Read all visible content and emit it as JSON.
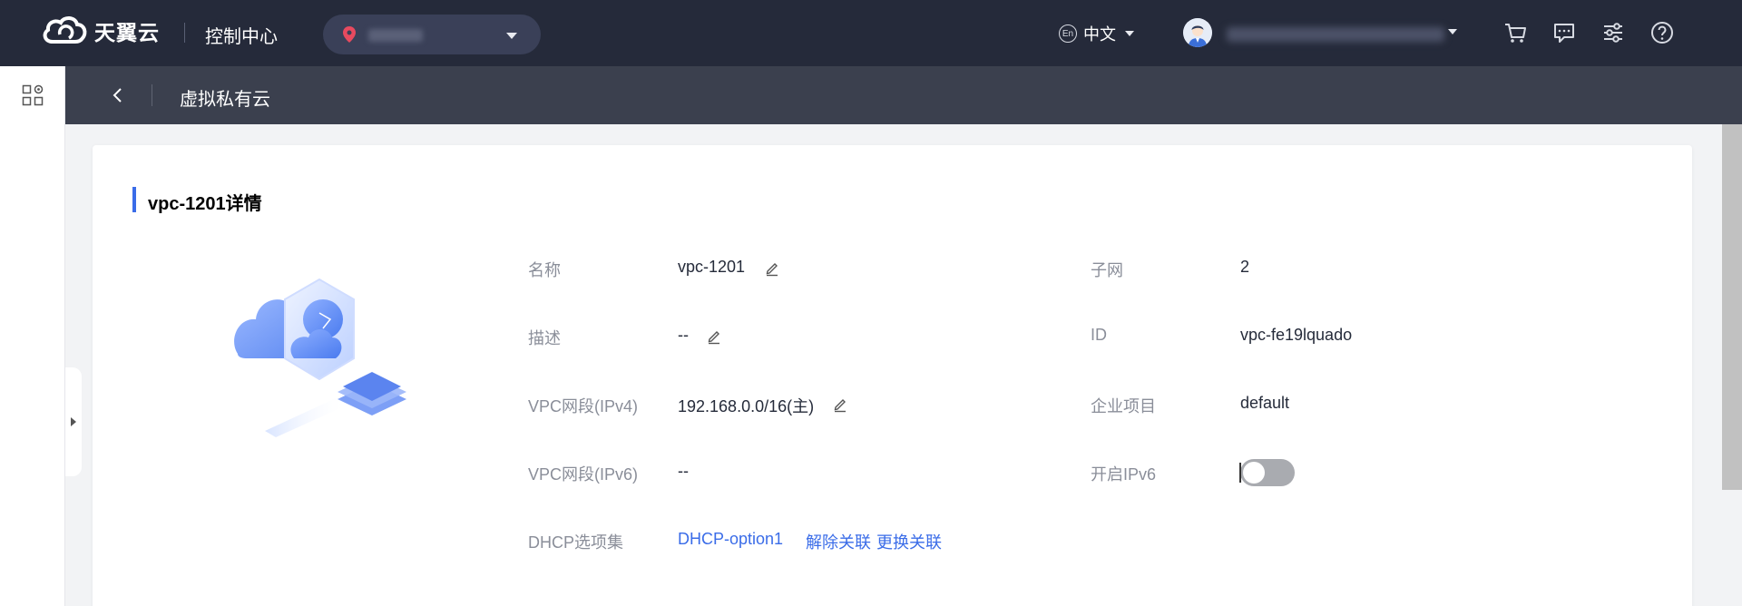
{
  "topbar": {
    "brand": "天翼云",
    "console_title": "控制中心",
    "language": "中文",
    "language_icon_text": "En",
    "icons": [
      "cart-icon",
      "message-icon",
      "settings-icon",
      "help-icon"
    ]
  },
  "subbar": {
    "title": "虚拟私有云"
  },
  "card": {
    "title": "vpc-1201详情",
    "fields_left": [
      {
        "label": "名称",
        "value": "vpc-1201",
        "editable": true
      },
      {
        "label": "描述",
        "value": "--",
        "editable": true
      },
      {
        "label": "VPC网段(IPv4)",
        "value": "192.168.0.0/16(主)",
        "editable": true
      },
      {
        "label": "VPC网段(IPv6)",
        "value": "--",
        "editable": false
      },
      {
        "label": "DHCP选项集",
        "value": "DHCP-option1",
        "actions": [
          "解除关联",
          "更换关联"
        ]
      }
    ],
    "fields_right": [
      {
        "label": "子网",
        "value": "2"
      },
      {
        "label": "ID",
        "value": "vpc-fe19lquado"
      },
      {
        "label": "企业项目",
        "value": "default"
      },
      {
        "label": "开启IPv6",
        "toggle_on": false
      }
    ]
  },
  "colors": {
    "topbar_bg": "#252a3a",
    "subbar_bg": "#3b404e",
    "accent": "#3a6ce8",
    "label_gray": "#8a8e99"
  }
}
